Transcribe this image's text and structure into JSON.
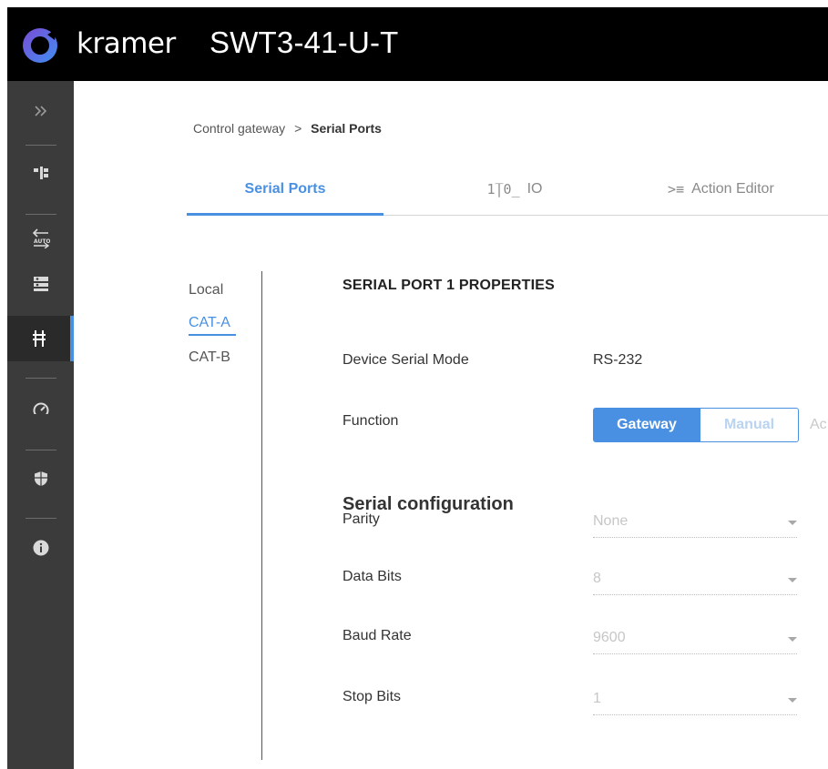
{
  "header": {
    "brand": "kramer",
    "title": "SWT3-41-U-T"
  },
  "sidebar": {
    "items": [
      {
        "icon": "expand-icon"
      },
      {
        "icon": "routing-icon"
      },
      {
        "icon": "auto-switch-icon"
      },
      {
        "icon": "device-settings-icon"
      },
      {
        "icon": "control-gateway-icon",
        "active": true
      },
      {
        "icon": "diagnostics-icon"
      },
      {
        "icon": "security-icon"
      },
      {
        "icon": "info-icon"
      }
    ]
  },
  "breadcrumb": {
    "parent": "Control gateway",
    "separator": ">",
    "current": "Serial Ports"
  },
  "tabs": [
    {
      "label": "Serial Ports",
      "active": true
    },
    {
      "label": "IO",
      "icon": "io-icon"
    },
    {
      "label": "Action Editor",
      "icon": "action-editor-icon"
    }
  ],
  "ports": [
    "Local",
    "CAT-A",
    "CAT-B"
  ],
  "properties": {
    "title": "SERIAL PORT 1 PROPERTIES",
    "device_serial_mode_label": "Device Serial Mode",
    "device_serial_mode_value": "RS-232",
    "function_label": "Function",
    "function_options": [
      "Gateway",
      "Manual",
      "Ac"
    ],
    "function_selected": "Gateway",
    "serial_config_heading": "Serial configuration",
    "parity_label": "Parity",
    "parity_value": "None",
    "data_bits_label": "Data Bits",
    "data_bits_value": "8",
    "baud_rate_label": "Baud Rate",
    "baud_rate_value": "9600",
    "stop_bits_label": "Stop Bits",
    "stop_bits_value": "1"
  },
  "colors": {
    "accent": "#4a90e2",
    "header_bg": "#000000",
    "sidebar_bg": "#3b3b3b"
  }
}
